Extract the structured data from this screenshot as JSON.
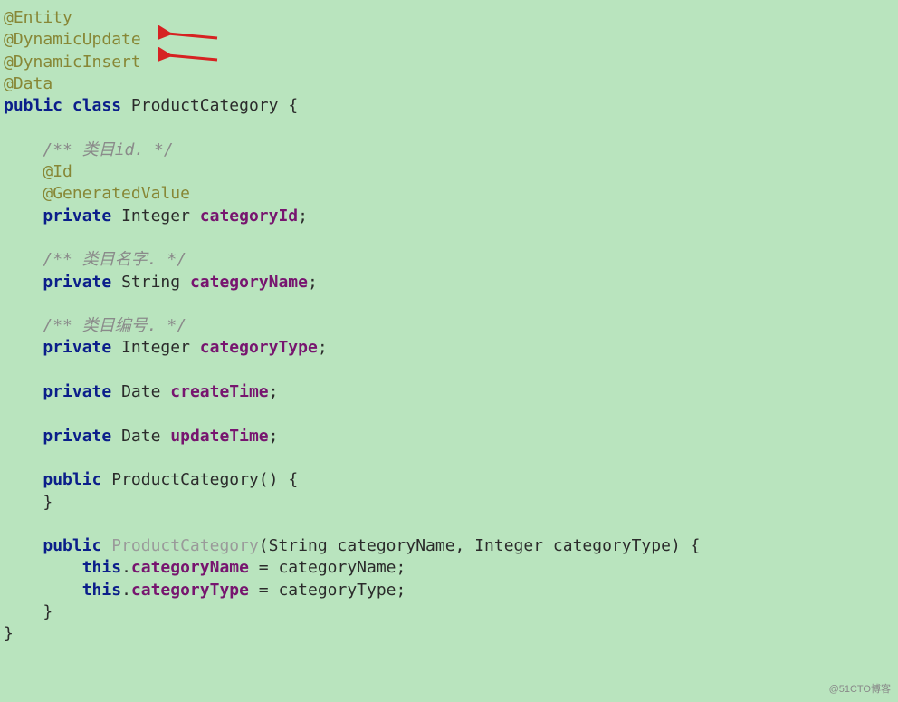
{
  "code": {
    "annotations": {
      "entity": "@Entity",
      "dynamicUpdate": "@DynamicUpdate",
      "dynamicInsert": "@DynamicInsert",
      "data": "@Data",
      "id": "@Id",
      "generatedValue": "@GeneratedValue"
    },
    "keywords": {
      "public": "public",
      "class": "class",
      "private": "private",
      "this": "this"
    },
    "className": "ProductCategory",
    "types": {
      "integer": "Integer",
      "string": "String",
      "date": "Date"
    },
    "fields": {
      "categoryId": "categoryId",
      "categoryName": "categoryName",
      "categoryType": "categoryType",
      "createTime": "createTime",
      "updateTime": "updateTime"
    },
    "comments": {
      "categoryId": "/** 类目id. */",
      "categoryName": "/** 类目名字. */",
      "categoryType": "/** 类目编号. */"
    },
    "constructor2Params": "(String categoryName, Integer categoryType)",
    "braces": {
      "open": "{",
      "close": "}",
      "openParen": "(",
      "closeParen": ")"
    },
    "punct": {
      "semi": ";",
      "dot": ".",
      "eq": " = "
    }
  },
  "watermark": "@51CTO博客"
}
